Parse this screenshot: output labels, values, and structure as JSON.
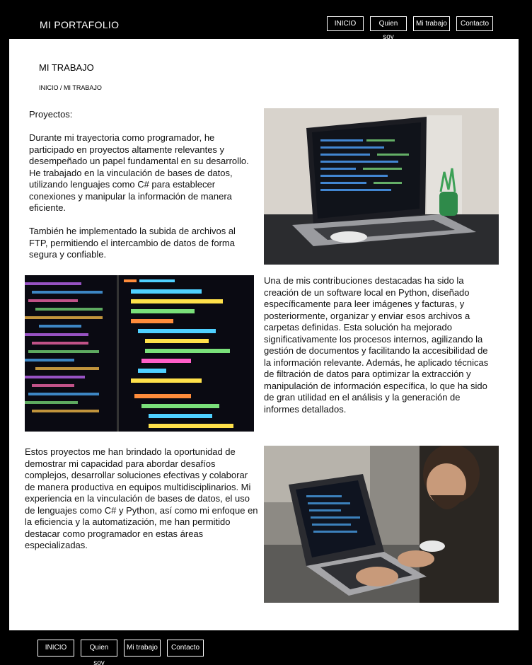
{
  "header": {
    "brand": "MI PORTAFOLIO",
    "nav": [
      "INICIO",
      "Quien soy",
      "Mi trabajo",
      "Contacto"
    ]
  },
  "main": {
    "title": "MI TRABAJO",
    "breadcrumb": "INICIO / MI TRABAJO",
    "section1": {
      "heading": "Proyectos:",
      "p1": "Durante mi trayectoria como programador, he participado en proyectos altamente relevantes y desempeñado un papel fundamental en su desarrollo. He trabajado en la vinculación de bases de datos, utilizando lenguajes como C# para establecer conexiones y manipular la información de manera eficiente.",
      "p2": "También he implementado la subida de archivos al FTP, permitiendo el intercambio de datos de forma segura y confiable."
    },
    "section2": {
      "p1": "Una de mis contribuciones destacadas ha sido la creación de un software local en Python, diseñado específicamente para leer imágenes y facturas, y posteriormente, organizar y enviar esos archivos a carpetas definidas. Esta solución ha mejorado significativamente los procesos internos, agilizando la gestión de documentos y facilitando la accesibilidad de la información relevante. Además, he aplicado técnicas de filtración de datos para optimizar la extracción y manipulación de información específica, lo que ha sido de gran utilidad en el análisis y la generación de informes detallados."
    },
    "section3": {
      "p1": "Estos proyectos me han brindado la oportunidad de demostrar mi capacidad para abordar desafíos complejos, desarrollar soluciones efectivas y colaborar de manera productiva en equipos multidisciplinarios. Mi experiencia en la vinculación de bases de datos, el uso de lenguajes como C# y Python, así como mi enfoque en la eficiencia y la automatización, me han permitido destacar como programador en estas áreas especializadas."
    }
  },
  "footer": {
    "nav": [
      "INICIO",
      "Quien soy",
      "Mi trabajo",
      "Contacto"
    ]
  },
  "colors": {
    "background": "#000000",
    "panel": "#ffffff",
    "text": "#111111"
  }
}
